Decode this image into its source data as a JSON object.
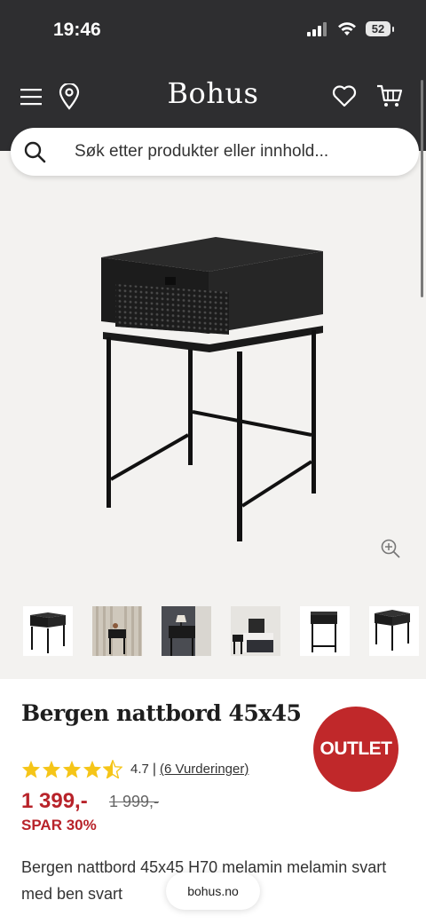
{
  "status": {
    "time": "19:46",
    "battery": "52"
  },
  "header": {
    "logo": "Bohus"
  },
  "search": {
    "placeholder": "Søk etter produkter eller innhold..."
  },
  "product": {
    "title": "Bergen nattbord 45x45",
    "badge": "OUTLET",
    "rating": {
      "stars": 4.7,
      "value": "4.7",
      "separator": "|",
      "reviews_link": "(6 Vurderinger)"
    },
    "price": "1 399,-",
    "old_price": "1 999,-",
    "discount": "SPAR 30%",
    "description": "Bergen nattbord 45x45 H70 melamin melamin svart med ben svart"
  },
  "thumbnails": [
    "product-studio",
    "lifestyle-wood-wall",
    "lifestyle-bedroom-lamp",
    "lifestyle-bedroom-dark",
    "product-front",
    "product-angle"
  ],
  "colors": {
    "header_bg": "#2e2e30",
    "accent_red": "#b8232a",
    "outlet_red": "#c0282a",
    "star": "#f5c518",
    "page_bg": "#f3f2f0"
  },
  "icons": [
    "menu-icon",
    "location-pin-icon",
    "heart-icon",
    "cart-icon",
    "search-icon",
    "zoom-in-icon",
    "star-icon"
  ],
  "browser": {
    "url": "bohus.no"
  }
}
